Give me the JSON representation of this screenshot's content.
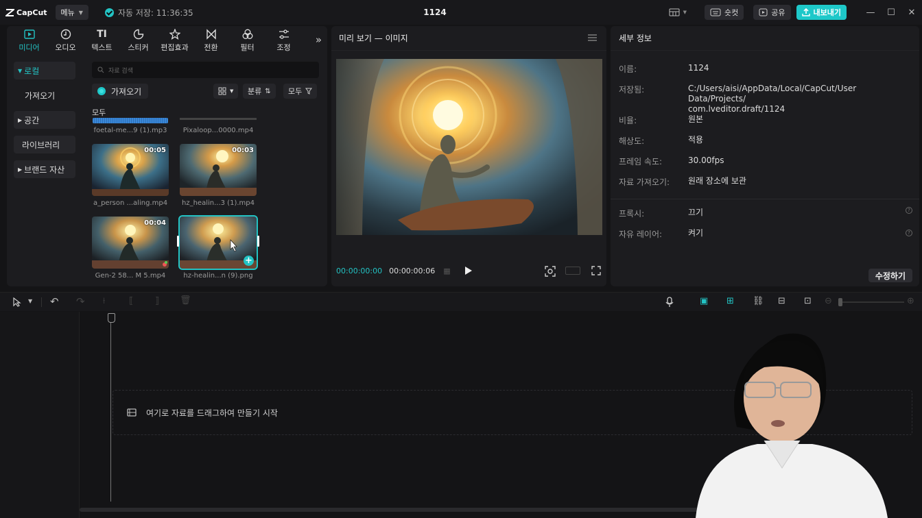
{
  "app": {
    "logo": "CapCut",
    "menu_label": "메뉴",
    "autosave": "자동 저장: 11:36:35",
    "project_title": "1124",
    "shortcut_label": "숏컷",
    "share_label": "공유",
    "export_label": "내보내기",
    "accent_color": "#23c3c4"
  },
  "toolbar": {
    "tabs": [
      {
        "label": "미디어",
        "icon": "media-icon"
      },
      {
        "label": "오디오",
        "icon": "audio-icon"
      },
      {
        "label": "텍스트",
        "icon": "text-icon"
      },
      {
        "label": "스티커",
        "icon": "sticker-icon"
      },
      {
        "label": "편집효과",
        "icon": "effects-icon"
      },
      {
        "label": "전환",
        "icon": "transition-icon"
      },
      {
        "label": "필터",
        "icon": "filter-icon"
      },
      {
        "label": "조정",
        "icon": "adjust-icon"
      }
    ],
    "text_glyph": "TI"
  },
  "media": {
    "sidebar": {
      "local": "로컬",
      "import": "가져오기",
      "space": "공간",
      "library": "라이브러리",
      "brand": "브랜드 자산"
    },
    "search_placeholder": "자료 검색",
    "import_button": "가져오기",
    "sort_label": "분류",
    "filter_label": "모두",
    "all_label": "모두",
    "clips": [
      {
        "name": "foetal-me...9 (1).mp3",
        "duration": ""
      },
      {
        "name": "Pixaloop...0000.mp4",
        "duration": ""
      },
      {
        "name": "a_person ...aling.mp4",
        "duration": "00:05"
      },
      {
        "name": "hz_healin...3 (1).mp4",
        "duration": "00:03"
      },
      {
        "name": "Gen-2 58... M 5.mp4",
        "duration": "00:04"
      },
      {
        "name": "hz-healin...n (9).png",
        "duration": ""
      }
    ]
  },
  "preview": {
    "title": "미리 보기 — 이미지",
    "current_time": "00:00:00:00",
    "total_time": "00:00:00:06"
  },
  "details": {
    "title": "세부 정보",
    "rows": [
      {
        "label": "이름:",
        "value": "1124"
      },
      {
        "label": "저장됨:",
        "value": "C:/Users/aisi/AppData/Local/CapCut/User Data/Projects/\ncom.lveditor.draft/1124"
      },
      {
        "label": "비율:",
        "value": "원본"
      },
      {
        "label": "해상도:",
        "value": "적용"
      },
      {
        "label": "프레임 속도:",
        "value": "30.00fps"
      },
      {
        "label": "자료 가져오기:",
        "value": "원래 장소에 보관"
      },
      {
        "label": "프록시:",
        "value": "끄기"
      },
      {
        "label": "자유 레이어:",
        "value": "켜기"
      }
    ],
    "edit_button": "수정하기"
  },
  "timeline": {
    "drop_hint": "여기로 자료를 드래그하여 만들기 시작"
  }
}
